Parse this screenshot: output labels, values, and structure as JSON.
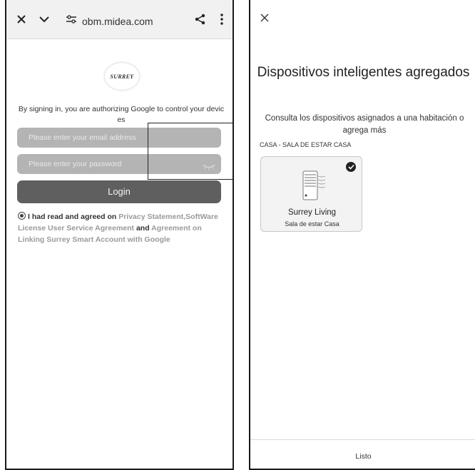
{
  "left_screen": {
    "browser": {
      "close_icon": "close-icon",
      "dropdown_icon": "chevron-down-icon",
      "site_settings_icon": "tune-icon",
      "url": "obm.midea.com",
      "share_icon": "share-icon",
      "menu_icon": "more-vert-icon"
    },
    "logo_text": "SURREY",
    "consent_text": "By signing in, you are authorizing Google to control your devic es",
    "email_placeholder": "Please enter your email address",
    "password_placeholder": "Please enter your password",
    "login_label": "Login",
    "agreement": {
      "prefix": "I had read and agreed on ",
      "privacy_link": "Privacy Statement",
      "comma": ",",
      "software_link": "SoftWare License User Service Agreement",
      "and": " and ",
      "linking_link": "Agreement on Linking Surrey Smart Account with Google"
    }
  },
  "right_screen": {
    "close_icon": "close-icon",
    "title": "Dispositivos inteligentes agregados",
    "subtitle": "Consulta los dispositivos asignados a una habitación o agrega más",
    "section_label": "CASA - SALA DE ESTAR CASA",
    "device": {
      "icon": "air-conditioner-icon",
      "name": "Surrey Living",
      "room": "Sala de estar Casa",
      "selected": true
    },
    "done_label": "Listo"
  }
}
